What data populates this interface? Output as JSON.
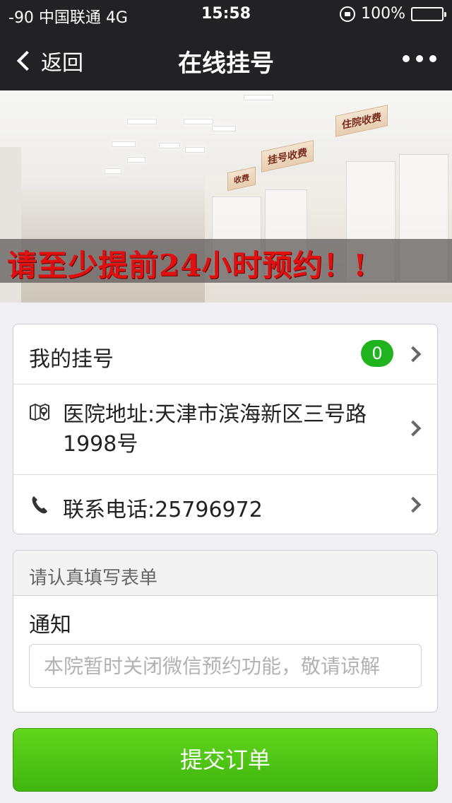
{
  "status_bar": {
    "carrier": "-90 中国联通  4G",
    "time": "15:58",
    "battery": "100%"
  },
  "nav": {
    "back_label": "返回",
    "title": "在线挂号"
  },
  "banner": {
    "notice": "请至少提前24小时预约！!",
    "signs": [
      "住院收费",
      "挂号收费",
      "收费"
    ]
  },
  "info": {
    "my_registration_label": "我的挂号",
    "my_registration_count": "0",
    "address": "医院地址:天津市滨海新区三号路1998号",
    "phone": "联系电话:25796972"
  },
  "form": {
    "header": "请认真填写表单",
    "notice_label": "通知",
    "notice_placeholder": "本院暂时关闭微信预约功能，敬请谅解"
  },
  "submit_label": "提交订单",
  "colors": {
    "nav_bg": "#222226",
    "accent_green": "#3fb50f",
    "badge_green": "#1fb41f",
    "banner_text": "#e01010"
  }
}
